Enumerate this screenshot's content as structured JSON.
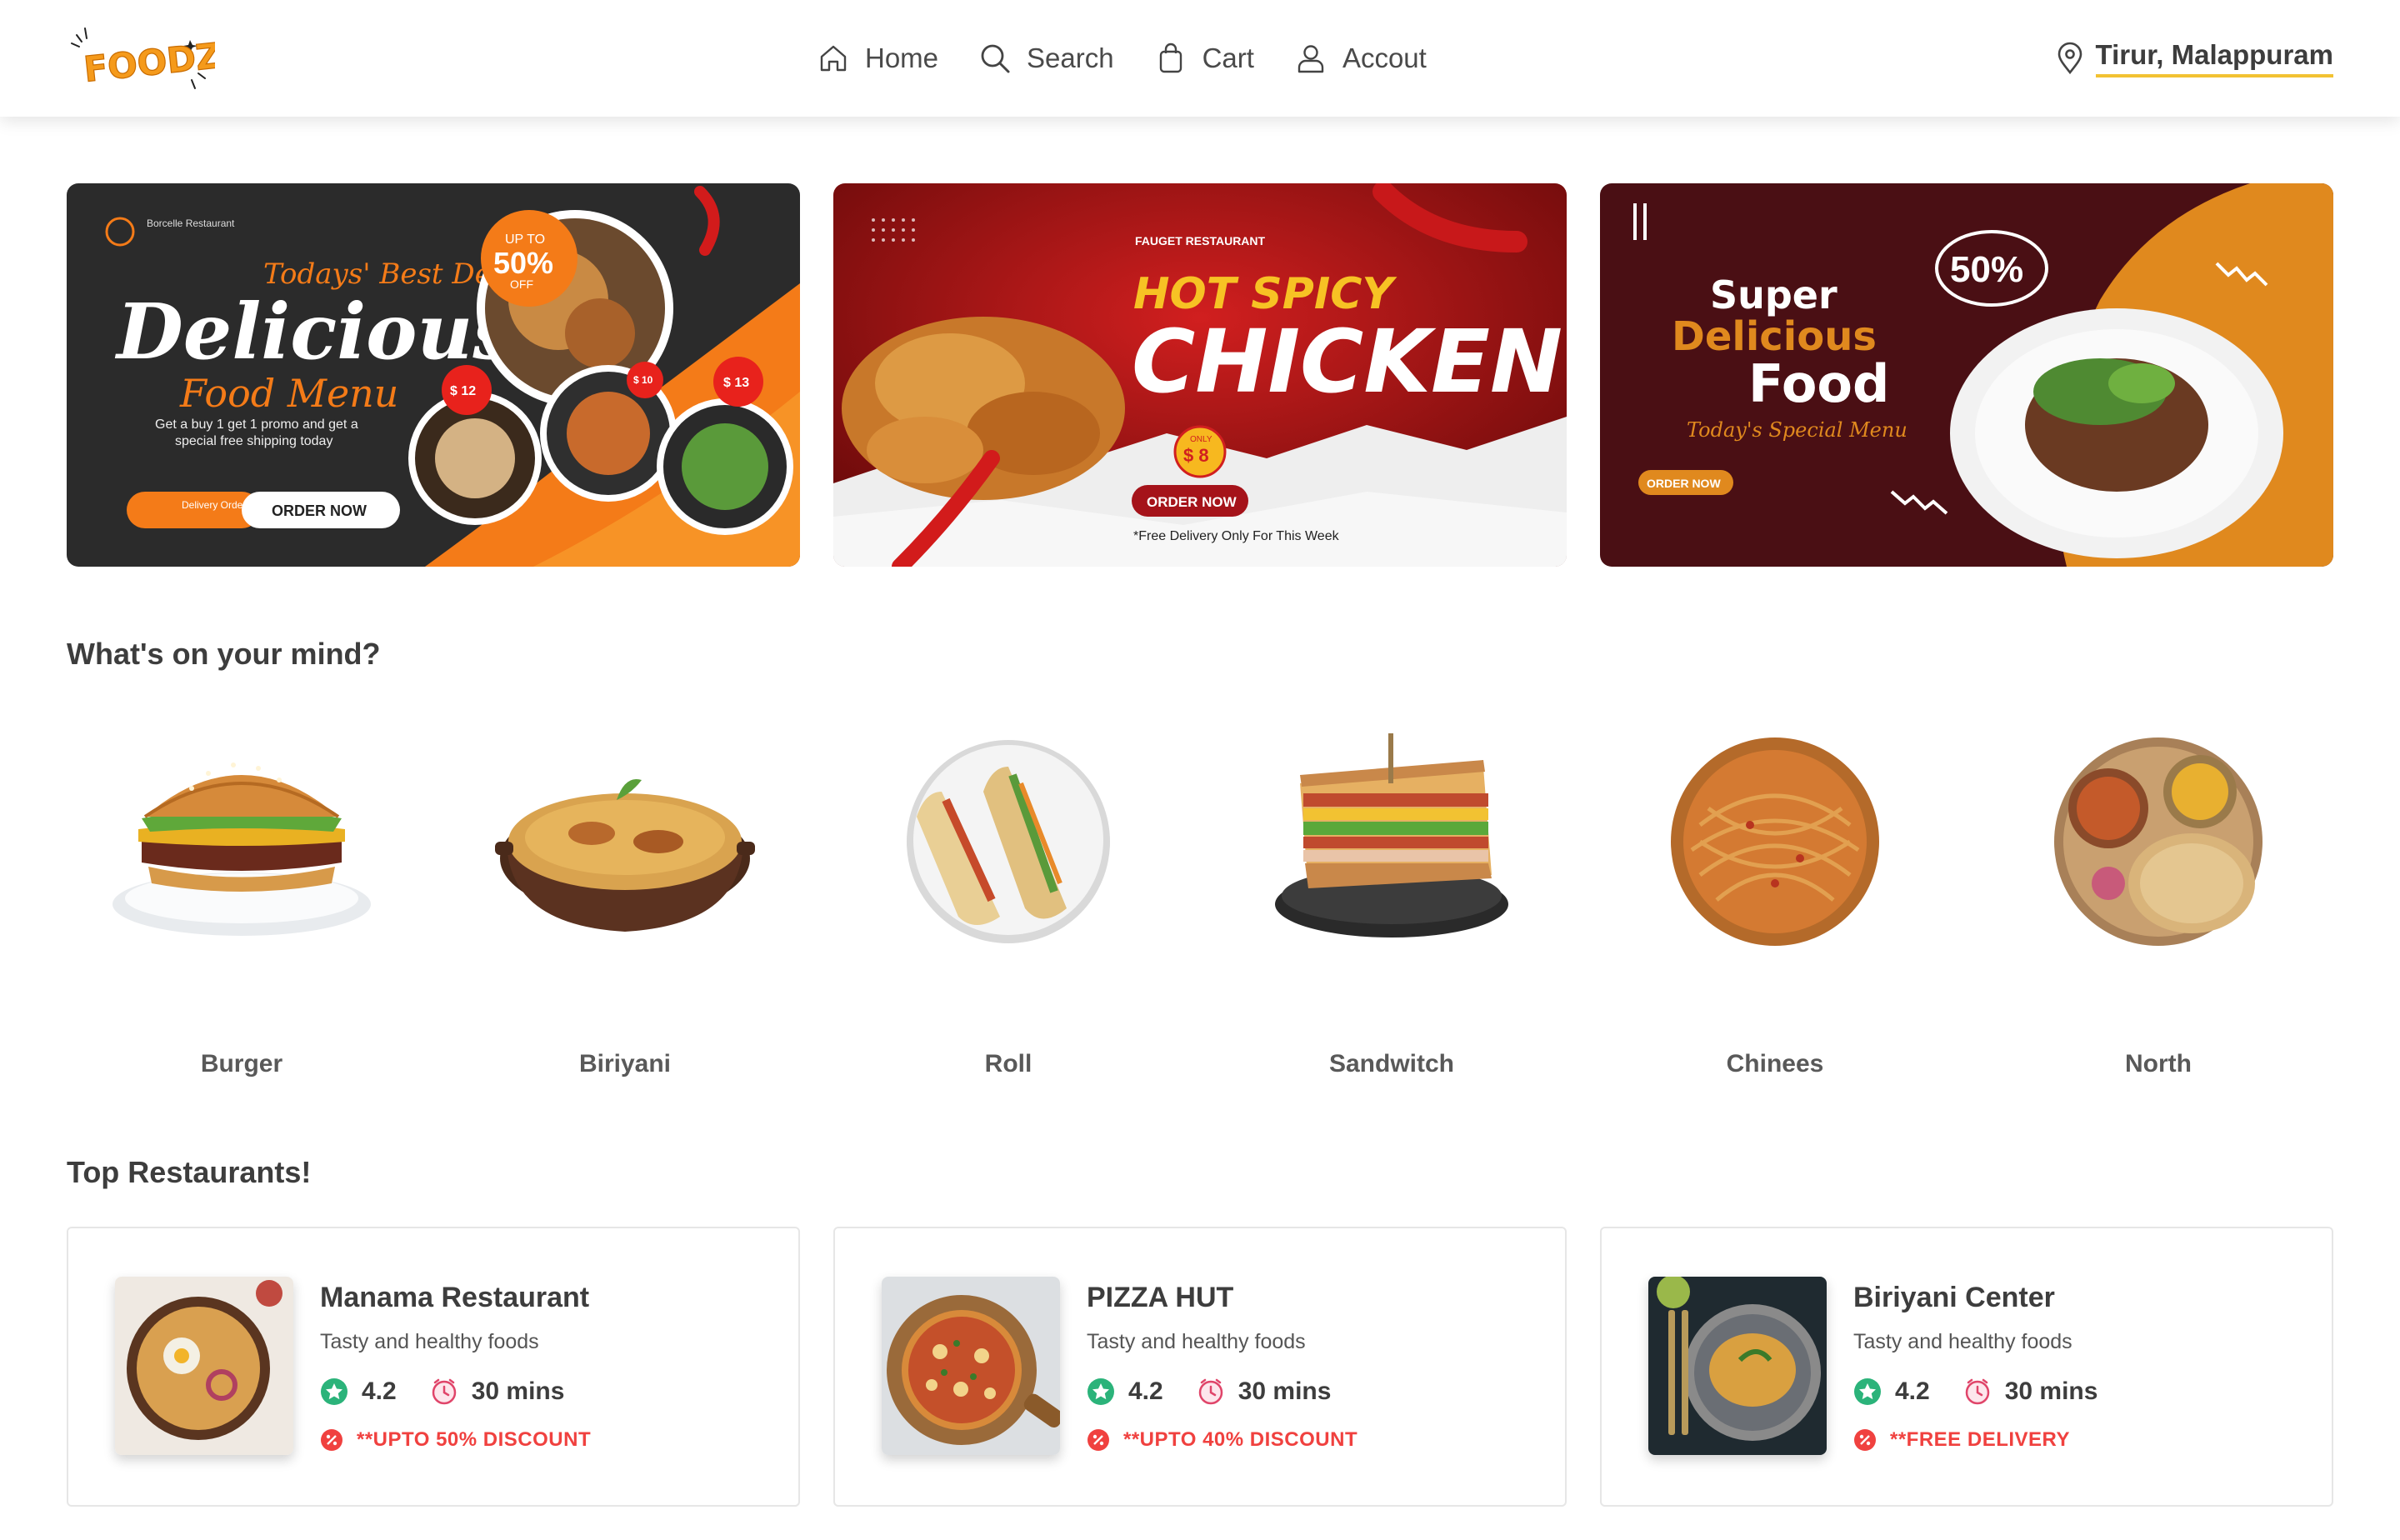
{
  "nav": {
    "logo_text": "FOODZ",
    "items": [
      {
        "label": "Home",
        "icon": "home-icon"
      },
      {
        "label": "Search",
        "icon": "search-icon"
      },
      {
        "label": "Cart",
        "icon": "bag-icon"
      },
      {
        "label": "Accout",
        "icon": "user-icon"
      }
    ],
    "location": "Tirur, Malappuram"
  },
  "banners": [
    {
      "brand": "Borcelle Restaurant",
      "tagline": "Todays' Best Deal",
      "headline": "Delicious",
      "subhead": "Food Menu",
      "discount_top": "UP TO",
      "discount": "50%",
      "discount_bottom": "OFF",
      "prices": [
        "$ 12",
        "$ 10",
        "$ 13"
      ],
      "desc_line1": "Get a buy 1 get 1 promo and get a",
      "desc_line2": "special free shipping today",
      "delivery_label": "Delivery Order",
      "cta": "ORDER NOW"
    },
    {
      "brand": "FAUGET RESTAURANT",
      "headline_1": "HOT SPICY",
      "headline_2": "CHICKEN",
      "only": "ONLY",
      "price": "$ 8",
      "cta": "ORDER NOW",
      "note": "*Free Delivery Only For This Week"
    },
    {
      "headline_1": "Super",
      "headline_2": "Delicious",
      "headline_3": "Food",
      "script": "Today's Special Menu",
      "discount": "50%",
      "cta": "ORDER NOW"
    }
  ],
  "mind_title": "What's on your mind?",
  "categories": [
    {
      "label": "Burger"
    },
    {
      "label": "Biriyani"
    },
    {
      "label": "Roll"
    },
    {
      "label": "Sandwitch"
    },
    {
      "label": "Chinees"
    },
    {
      "label": "North"
    }
  ],
  "top_title": "Top Restaurants!",
  "restaurants": [
    {
      "name": "Manama Restaurant",
      "desc": "Tasty and healthy foods",
      "rating": "4.2",
      "time": "30 mins",
      "offer": "**UPTO 50% DISCOUNT"
    },
    {
      "name": "PIZZA HUT",
      "desc": "Tasty and healthy foods",
      "rating": "4.2",
      "time": "30 mins",
      "offer": "**UPTO 40% DISCOUNT"
    },
    {
      "name": "Biriyani Center",
      "desc": "Tasty and healthy foods",
      "rating": "4.2",
      "time": "30 mins",
      "offer": "**FREE DELIVERY"
    }
  ],
  "colors": {
    "accent_yellow": "#f2c232",
    "offer_red": "#f0413f",
    "rating_green": "#2bb37a",
    "logo_orange": "#f59a1b"
  }
}
